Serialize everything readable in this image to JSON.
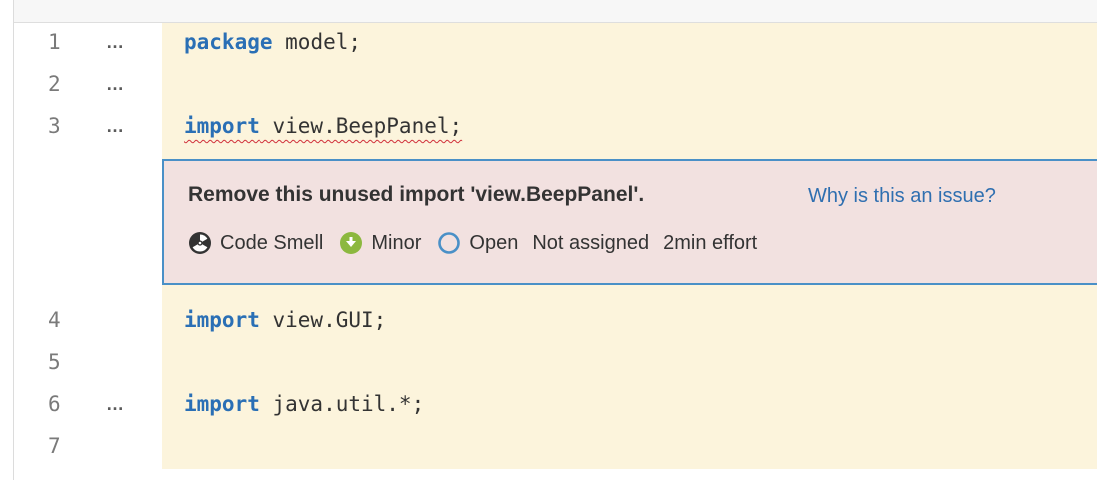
{
  "code_lines": [
    {
      "num": "1",
      "ellipsis": "…",
      "keyword": "package",
      "rest": " model;"
    },
    {
      "num": "2",
      "ellipsis": "…",
      "keyword": "",
      "rest": ""
    },
    {
      "num": "3",
      "ellipsis": "…",
      "keyword": "import",
      "rest": " view.BeepPanel;"
    },
    {
      "num": "4",
      "ellipsis": "",
      "keyword": "import",
      "rest": " view.GUI;"
    },
    {
      "num": "5",
      "ellipsis": "",
      "keyword": "",
      "rest": ""
    },
    {
      "num": "6",
      "ellipsis": "…",
      "keyword": "import",
      "rest": " java.util.*;"
    },
    {
      "num": "7",
      "ellipsis": "",
      "keyword": "",
      "rest": ""
    }
  ],
  "issue": {
    "message": "Remove this unused import 'view.BeepPanel'.",
    "why_link": "Why is this an issue?",
    "type": "Code Smell",
    "severity": "Minor",
    "status": "Open",
    "assignee": "Not assigned",
    "effort": "2min effort"
  },
  "icons": {
    "type": "code-smell-icon",
    "severity": "minor-severity-icon",
    "status": "open-status-icon"
  },
  "colors": {
    "code_bg": "#fcf4dc",
    "keyword": "#2a6fb5",
    "issue_bg": "#f2e1e0",
    "issue_border": "#4a90c7",
    "link": "#2f6fb0",
    "minor_green": "#8cb83f"
  }
}
